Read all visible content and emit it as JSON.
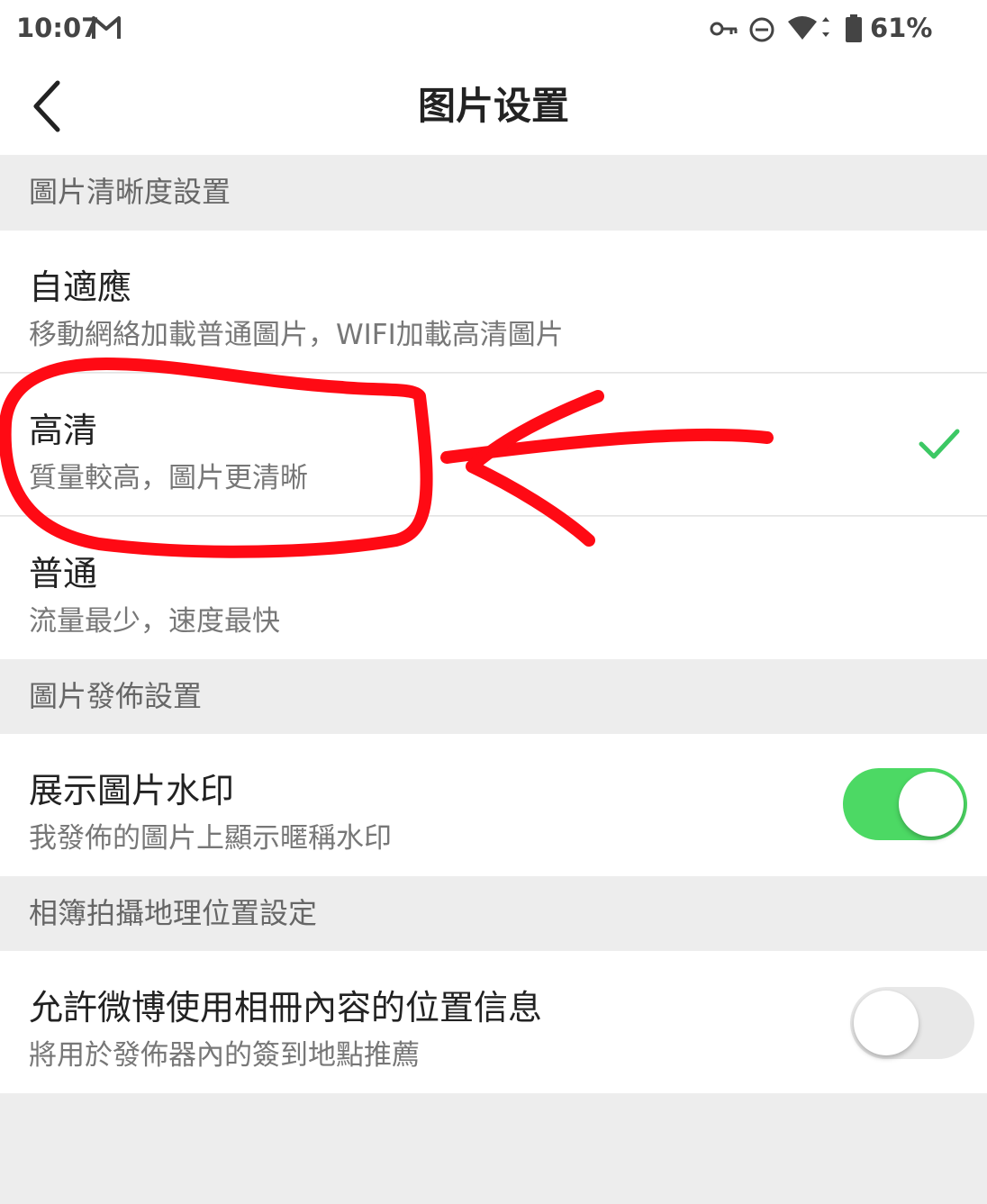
{
  "status_bar": {
    "time": "10:07",
    "battery": "61%",
    "icons": [
      "gmail-icon",
      "vpn-key-icon",
      "do-not-disturb-icon",
      "wifi-icon",
      "battery-icon"
    ]
  },
  "nav": {
    "title": "图片设置",
    "back_icon": "back-chevron-icon"
  },
  "sections": {
    "clarity": {
      "header": "圖片清晰度設置",
      "options": [
        {
          "title": "自適應",
          "subtitle": "移動網絡加載普通圖片，WIFI加載高清圖片",
          "selected": false
        },
        {
          "title": "高清",
          "subtitle": "質量較高，圖片更清晰",
          "selected": true
        },
        {
          "title": "普通",
          "subtitle": "流量最少，速度最快",
          "selected": false
        }
      ]
    },
    "publish": {
      "header": "圖片發佈設置",
      "watermark": {
        "title": "展示圖片水印",
        "subtitle": "我發佈的圖片上顯示暱稱水印",
        "enabled": true
      }
    },
    "location": {
      "header": "相簿拍攝地理位置設定",
      "allow": {
        "title": "允許微博使用相冊內容的位置信息",
        "subtitle": "將用於發佈器內的簽到地點推薦",
        "enabled": false
      }
    }
  },
  "colors": {
    "accent_green": "#4cd964",
    "check_green": "#3cc864",
    "annotation_red": "#ff0a14",
    "section_bg": "#ededed"
  }
}
